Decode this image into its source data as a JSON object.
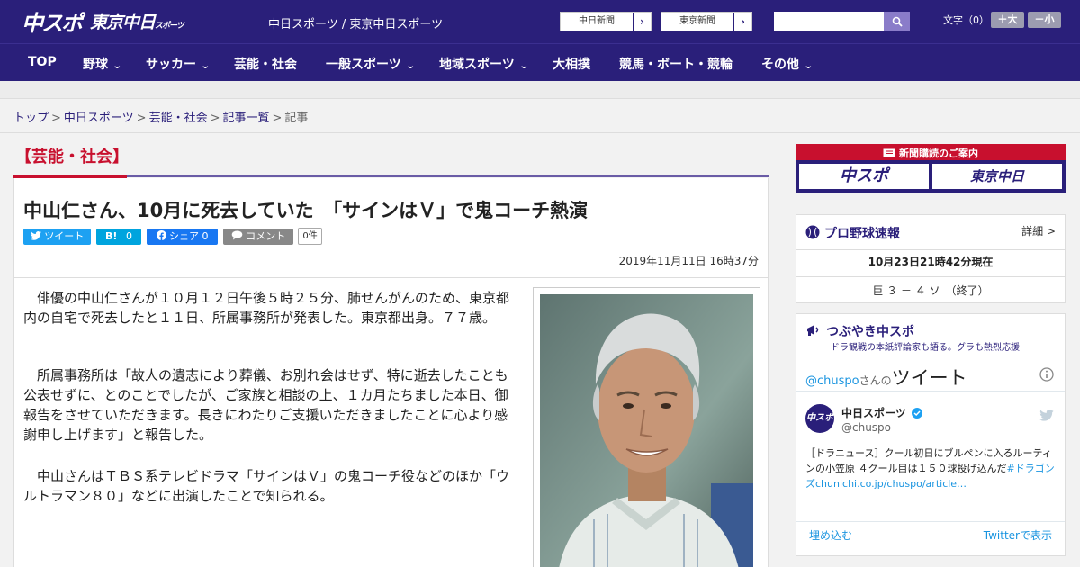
{
  "header": {
    "logo_chunichi": "中スポ",
    "logo_tokyo": "東京中日",
    "logo_tokyo_suffix": "スポーツ",
    "site_links": "中日スポーツ / 東京中日スポーツ",
    "chunichi_news_btn": "中日新聞",
    "tokyo_news_btn": "東京新聞",
    "btn_arrow": "›",
    "search_placeholder": "",
    "font_label": "文字（0）",
    "font_up": "＋大",
    "font_down": "－小"
  },
  "nav": {
    "items": [
      "TOP",
      "野球",
      "サッカー",
      "芸能・社会",
      "一般スポーツ",
      "地域スポーツ",
      "大相撲",
      "競馬・ボート・競輪",
      "その他"
    ],
    "chevron": "⌄"
  },
  "breadcrumb": {
    "items": [
      "トップ",
      "中日スポーツ",
      "芸能・社会",
      "記事一覧"
    ],
    "current": "記事",
    "sep": ">"
  },
  "article": {
    "category": "【芸能・社会】",
    "headline": "中山仁さん、10月に死去していた　「サインはＶ」で鬼コーチ熱演",
    "share": {
      "tweet": "ツイート",
      "hatena_mark": "B!",
      "hatena_count": "0",
      "facebook": "シェア",
      "facebook_count": "0",
      "comment": "コメント",
      "comment_count": "0件"
    },
    "date": "2019年11月11日 16時37分",
    "paragraphs": [
      "俳優の中山仁さんが１０月１２日午後５時２５分、肺せんがんのため、東京都内の自宅で死去したと１１日、所属事務所が発表した。東京都出身。７７歳。",
      "所属事務所は「故人の遺志により葬儀、お別れ会はせず、特に逝去したことも公表せずに、とのことでしたが、ご家族と相談の上、１カ月たちました本日、御報告をさせていただきます。長きにわたりご支援いただきましたことに心より感謝申し上げます」と報告した。",
      "中山さんはＴＢＳ系テレビドラマ「サインはＶ」の鬼コーチ役などのほか「ウルトラマン８０」などに出演したことで知られる。"
    ]
  },
  "sidebar": {
    "ad_title": "新聞購読のご案内",
    "ad_chunichi": "中スポ",
    "ad_tokyo": "東京中日",
    "baseball": {
      "title": "プロ野球速報",
      "detail": "詳細 >",
      "time": "10月23日21時42分現在",
      "score": "巨 ３ － ４ ソ　（終了）"
    },
    "twitter": {
      "title": "つぶやき中スポ",
      "subtitle": "ドラ観戦の本紙評論家も語る。グラも熱烈応援",
      "handle": "@chuspo",
      "handle_suffix": "さんの",
      "tweet_word": "ツイート",
      "name": "中日スポーツ",
      "username": "@chuspo",
      "avatar_text": "中スポ",
      "text_plain": "［ドラニュース］クール初日にブルペンに入るルーティンの小笠原 ４クール目は１５０球投げ込んだ",
      "text_link": "#ドラゴンズ",
      "text_url": "chunichi.co.jp/chuspo/article…",
      "embed": "埋め込む",
      "view": "Twitterで表示"
    }
  },
  "colors": {
    "brand": "#2a1f7a",
    "accent_red": "#c8102e",
    "twitter": "#1da1f2",
    "hatena": "#00a4de",
    "facebook": "#1877f2",
    "comment": "#888888"
  }
}
